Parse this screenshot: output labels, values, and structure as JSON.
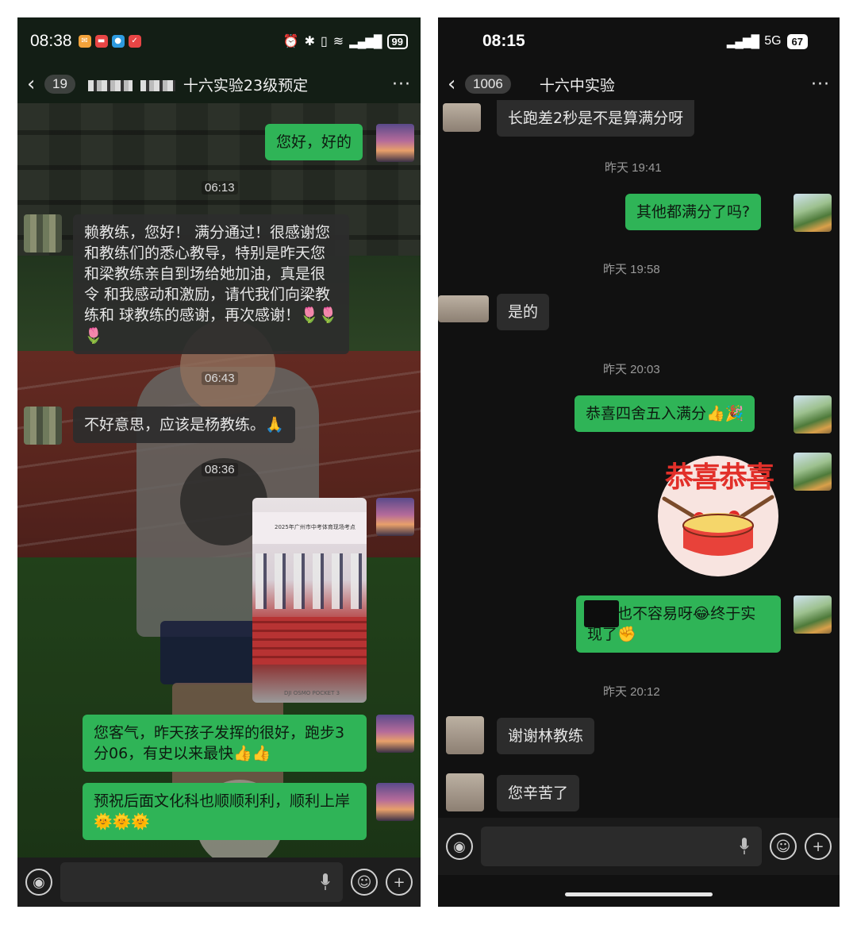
{
  "left": {
    "status": {
      "time": "08:38",
      "battery": "99"
    },
    "nav": {
      "back_count": "19",
      "title": "十六实验23级预定"
    },
    "messages": {
      "m1": "您好，好的",
      "t1": "06:13",
      "m2": "赖教练，您好！      满分通过！很感谢您和教练们的悉心教导，特别是昨天您和梁教练亲自到场给她加油，真是很令        和我感动和激励，请代我们向梁教练和  球教练的感谢，再次感谢！🌷🌷🌷",
      "t2": "06:43",
      "m3": "不好意思，应该是杨教练。🙏",
      "t3": "08:36",
      "photo_banner": "2025年广州市中考体育现场考点",
      "photo_logo": "DJI OSMO POCKET 3",
      "m4": "您客气，昨天孩子发挥的很好，跑步3分06，有史以来最快👍👍",
      "m5": "预祝后面文化科也顺顺利利，顺利上岸🌞🌞🌞"
    }
  },
  "right": {
    "status": {
      "time": "08:15",
      "network": "5G",
      "battery": "67"
    },
    "nav": {
      "back_count": "1006",
      "title": "十六中实验"
    },
    "messages": {
      "m0": "长跑差2秒是不是算满分呀",
      "t1": "昨天 19:41",
      "m1": "其他都满分了吗?",
      "t2": "昨天 19:58",
      "m2": "是的",
      "t3": "昨天 20:03",
      "m3": "恭喜四舍五入满分👍🎉",
      "sticker_text": "恭喜恭喜",
      "m4": "   满分也不容易呀😂终于实现了✊",
      "t4": "昨天 20:12",
      "m5": "谢谢林教练",
      "m6": "您辛苦了"
    }
  },
  "colors": {
    "outgoing_bubble": "#2fb457",
    "incoming_bubble": "#2c2c2c"
  }
}
